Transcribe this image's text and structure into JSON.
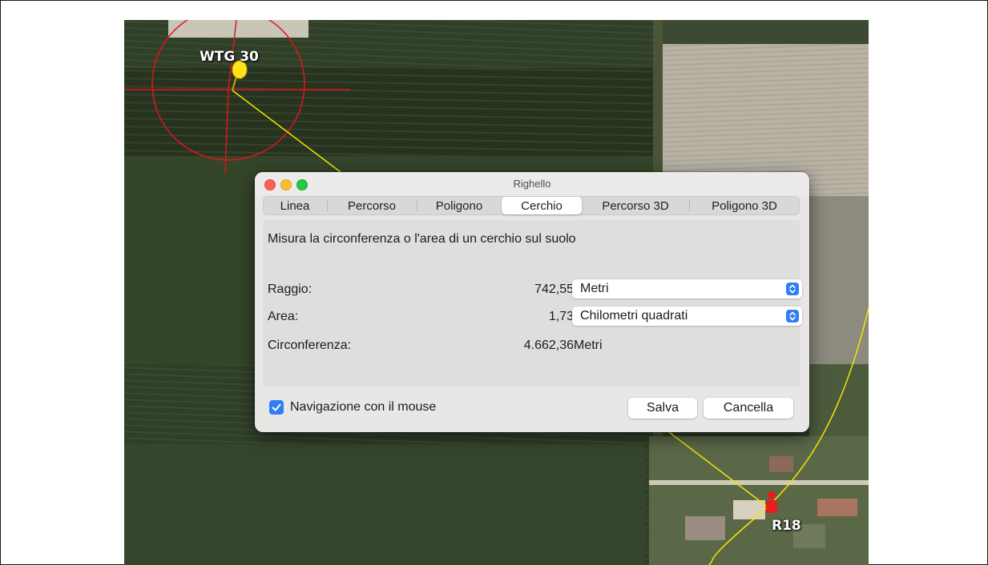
{
  "map": {
    "marker_top_label": "WTG 30",
    "marker_bottom_label": "R18"
  },
  "dialog": {
    "title": "Righello",
    "tabs": [
      "Linea",
      "Percorso",
      "Poligono",
      "Cerchio",
      "Percorso 3D",
      "Poligono 3D"
    ],
    "active_tab": "Cerchio",
    "description": "Misura la circonferenza o l'area di un cerchio sul suolo",
    "radius": {
      "label": "Raggio:",
      "value": "742,55",
      "unit": "Metri"
    },
    "area": {
      "label": "Area:",
      "value": "1,73",
      "unit": "Chilometri quadrati"
    },
    "circumference": {
      "label": "Circonferenza:",
      "value": "4.662,36",
      "unit": "Metri"
    },
    "mouse_navigation": {
      "label": "Navigazione con il mouse",
      "checked": true
    },
    "save_label": "Salva",
    "cancel_label": "Cancella"
  },
  "colors": {
    "accent": "#2f7ef6",
    "circle": "#e0151c",
    "line": "#f2e600"
  }
}
